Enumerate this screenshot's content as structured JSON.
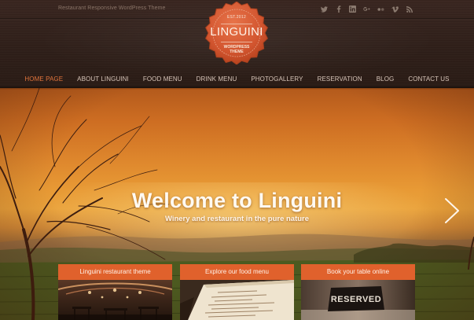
{
  "header": {
    "tagline": "Restaurant Responsive WordPress Theme",
    "logo": {
      "est": "EST.2012",
      "name": "LINGUINI",
      "subtitle_line1": "WORDPRESS",
      "subtitle_line2": "THEME"
    },
    "socials": [
      {
        "name": "twitter-icon",
        "glyph": "t"
      },
      {
        "name": "facebook-icon",
        "glyph": "f"
      },
      {
        "name": "linkedin-icon",
        "glyph": "in"
      },
      {
        "name": "google-plus-icon",
        "glyph": "g+"
      },
      {
        "name": "flickr-icon",
        "glyph": "••"
      },
      {
        "name": "vimeo-icon",
        "glyph": "V"
      },
      {
        "name": "rss-icon",
        "glyph": ")"
      }
    ]
  },
  "nav": {
    "items": [
      {
        "label": "HOME PAGE",
        "active": true
      },
      {
        "label": "ABOUT LINGUINI",
        "active": false
      },
      {
        "label": "FOOD MENU",
        "active": false
      },
      {
        "label": "DRINK MENU",
        "active": false
      },
      {
        "label": "PHOTOGALLERY",
        "active": false
      },
      {
        "label": "RESERVATION",
        "active": false
      },
      {
        "label": "BLOG",
        "active": false
      },
      {
        "label": "CONTACT US",
        "active": false
      }
    ]
  },
  "hero": {
    "title": "Welcome to Linguini",
    "subtitle": "Winery and restaurant in the pure nature"
  },
  "features": [
    {
      "label": "Linguini restaurant theme"
    },
    {
      "label": "Explore our food menu"
    },
    {
      "label": "Book your table online",
      "image_text": "RESERVED"
    }
  ],
  "colors": {
    "accent": "#e0612c",
    "nav_active": "#e0743c",
    "header_bg": "#2f1f19"
  }
}
